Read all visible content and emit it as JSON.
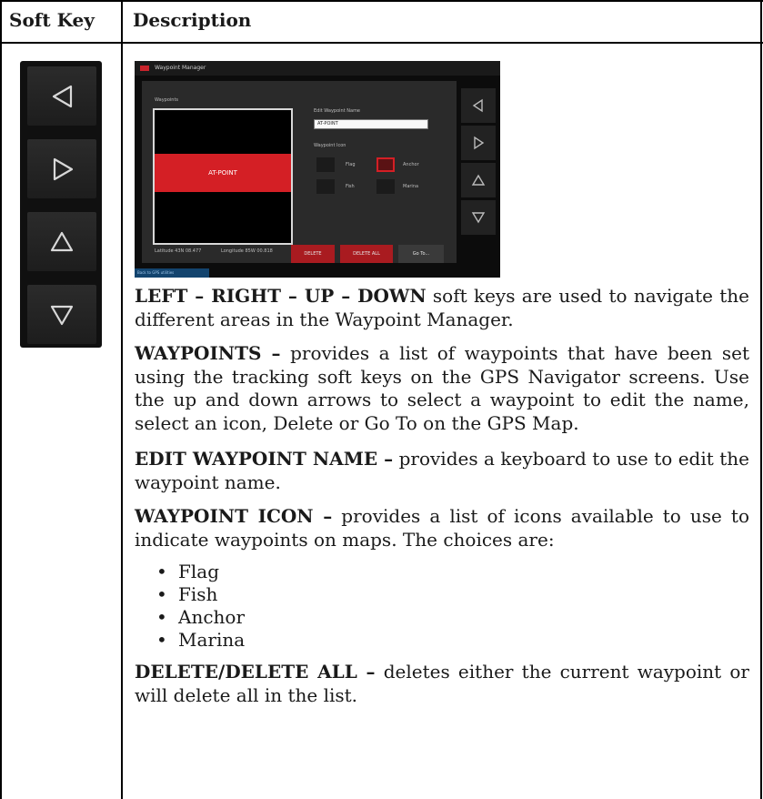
{
  "table": {
    "header_soft_key": "Soft Key",
    "header_description": "Description"
  },
  "soft_keys": [
    {
      "icon": "left-arrow-icon"
    },
    {
      "icon": "right-arrow-icon"
    },
    {
      "icon": "up-arrow-icon"
    },
    {
      "icon": "down-arrow-icon"
    }
  ],
  "screenshot": {
    "title": "Waypoint Manager",
    "waypoints_label": "Waypoints",
    "selected_waypoint": "AT-POINT",
    "edit_name_label": "Edit Waypoint Name",
    "name_value": "AT-POINT",
    "icon_label": "Waypoint Icon",
    "icons": [
      "Flag",
      "Anchor",
      "Fish",
      "Marina"
    ],
    "latitude": "Latitude 43N 08.477",
    "longitude": "Longitude 85W 00.818",
    "buttons": [
      "DELETE",
      "DELETE ALL",
      "Go To..."
    ],
    "status": "Back to GPS utilities"
  },
  "description": {
    "p1_bold": "LEFT – RIGHT – UP – DOWN",
    "p1_text": " soft keys are used to navigate the different areas in the Waypoint Manager.",
    "p2_bold": "WAYPOINTS –",
    "p2_text": " provides a list of waypoints that have been set using the tracking soft keys on the GPS Navigator screens. Use the up and down arrows to select a waypoint to edit the name, select an icon, Delete or Go To on the GPS Map.",
    "p3_bold": "EDIT WAYPOINT NAME –",
    "p3_text": " provides a keyboard to use to edit the waypoint name.",
    "p4_bold": "WAYPOINT ICON –",
    "p4_text": " provides a list of icons available to use to indicate waypoints on maps. The choices are:",
    "choices": [
      "Flag",
      "Fish",
      "Anchor",
      "Marina"
    ],
    "p5_bold": "DELETE/DELETE ALL –",
    "p5_text": " deletes either the current waypoint or will delete all in the list."
  }
}
